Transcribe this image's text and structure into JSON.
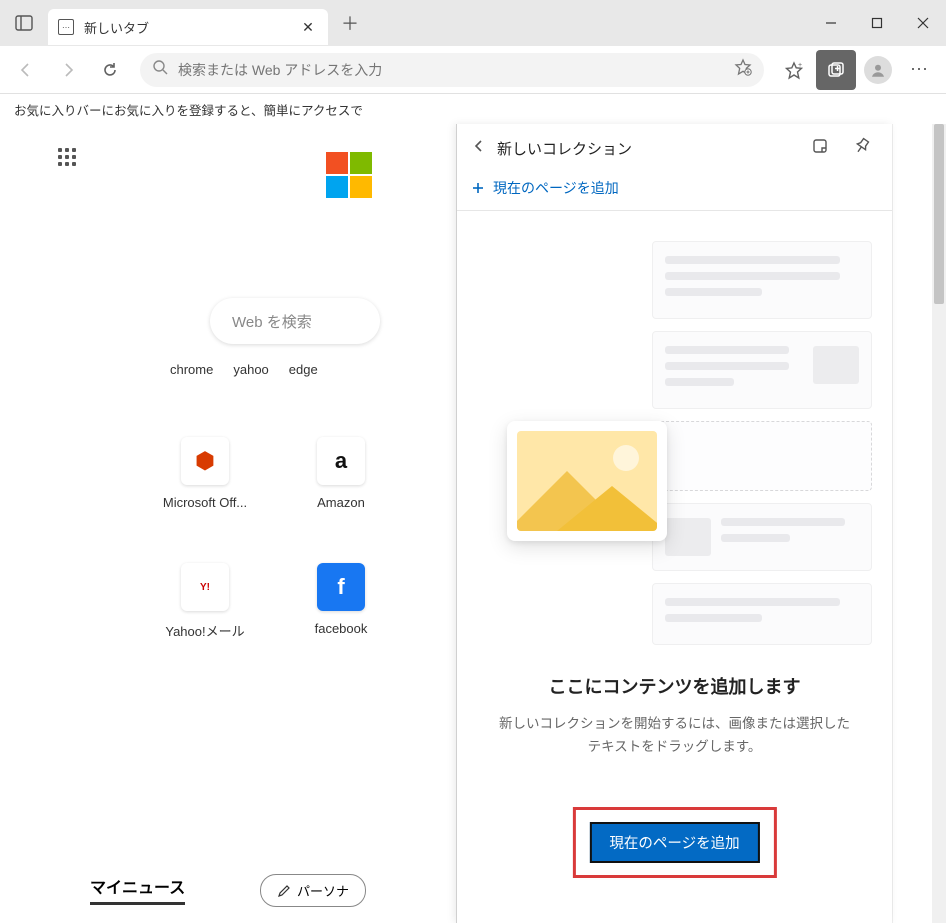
{
  "window": {
    "tab_title": "新しいタブ"
  },
  "toolbar": {
    "placeholder": "検索または Web アドレスを入力"
  },
  "bookmarks_bar": {
    "hint": "お気に入りバーにお気に入りを登録すると、簡単にアクセスで"
  },
  "newtab": {
    "search_placeholder": "Web を検索",
    "toplinks": [
      "chrome",
      "yahoo",
      "edge"
    ],
    "shortcuts": [
      {
        "label": "Microsoft Off..."
      },
      {
        "label": "Amazon"
      },
      {
        "label": "Yahoo!メール"
      },
      {
        "label": "facebook"
      }
    ],
    "mynews": "マイニュース",
    "personalize": "パーソナ"
  },
  "panel": {
    "title": "新しいコレクション",
    "add_current_link": "現在のページを追加",
    "empty_heading": "ここにコンテンツを追加します",
    "empty_body": "新しいコレクションを開始するには、画像または選択したテキストをドラッグします。",
    "cta_button": "現在のページを追加"
  }
}
